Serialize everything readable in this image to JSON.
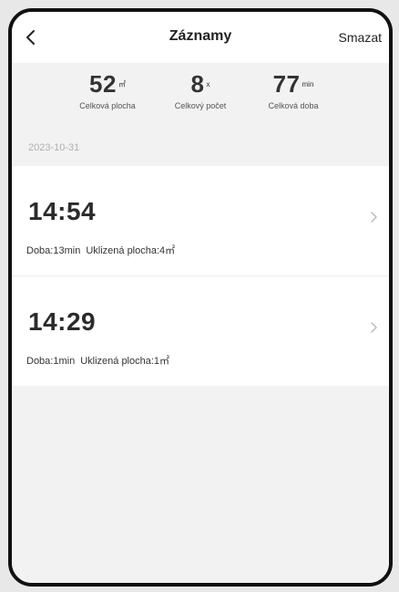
{
  "header": {
    "title": "Záznamy",
    "delete_label": "Smazat",
    "back_icon": "chevron-left-icon"
  },
  "summary": {
    "area": {
      "value": "52",
      "unit": "㎡",
      "label": "Celková plocha"
    },
    "count": {
      "value": "8",
      "unit": "x",
      "label": "Celkový počet"
    },
    "duration": {
      "value": "77",
      "unit": "min",
      "label": "Celková doba"
    }
  },
  "date": "2023-10-31",
  "records": [
    {
      "time": "14:54",
      "duration_label": "Doba:13min",
      "area_label": "Uklizená plocha:4㎡"
    },
    {
      "time": "14:29",
      "duration_label": "Doba:1min",
      "area_label": "Uklizená plocha:1㎡"
    }
  ],
  "colors": {
    "background": "#f2f2f2",
    "card": "#ffffff",
    "text": "#222222",
    "muted": "#b0b0b0"
  }
}
